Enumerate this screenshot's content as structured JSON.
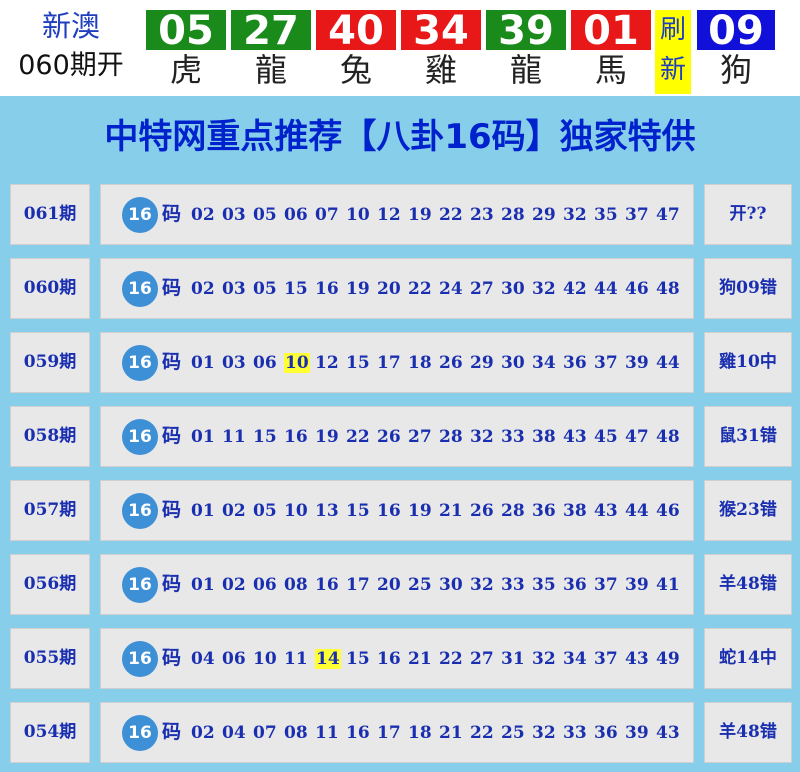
{
  "header": {
    "lottery_name": "新澳",
    "period_open": "060期开",
    "refresh_label": "刷新",
    "balls": [
      {
        "number": "05",
        "zodiac": "虎",
        "color": "#1a8a1a"
      },
      {
        "number": "27",
        "zodiac": "龍",
        "color": "#1a8a1a"
      },
      {
        "number": "40",
        "zodiac": "兔",
        "color": "#e81818"
      },
      {
        "number": "34",
        "zodiac": "雞",
        "color": "#e81818"
      },
      {
        "number": "39",
        "zodiac": "龍",
        "color": "#1a8a1a"
      },
      {
        "number": "01",
        "zodiac": "馬",
        "color": "#e81818"
      },
      {
        "number": "09",
        "zodiac": "狗",
        "color": "#1010d8"
      }
    ]
  },
  "banner": {
    "title": "中特网重点推荐【八卦16码】独家特供"
  },
  "badge_label": "16",
  "ma_label": "码",
  "rows": [
    {
      "period": "061期",
      "result": "开??",
      "highlight": "",
      "numbers": [
        "02",
        "03",
        "05",
        "06",
        "07",
        "10",
        "12",
        "19",
        "22",
        "23",
        "28",
        "29",
        "32",
        "35",
        "37",
        "47"
      ]
    },
    {
      "period": "060期",
      "result": "狗09错",
      "highlight": "",
      "numbers": [
        "02",
        "03",
        "05",
        "15",
        "16",
        "19",
        "20",
        "22",
        "24",
        "27",
        "30",
        "32",
        "42",
        "44",
        "46",
        "48"
      ]
    },
    {
      "period": "059期",
      "result": "雞10中",
      "highlight": "10",
      "numbers": [
        "01",
        "03",
        "06",
        "10",
        "12",
        "15",
        "17",
        "18",
        "26",
        "29",
        "30",
        "34",
        "36",
        "37",
        "39",
        "44"
      ]
    },
    {
      "period": "058期",
      "result": "鼠31错",
      "highlight": "",
      "numbers": [
        "01",
        "11",
        "15",
        "16",
        "19",
        "22",
        "26",
        "27",
        "28",
        "32",
        "33",
        "38",
        "43",
        "45",
        "47",
        "48"
      ]
    },
    {
      "period": "057期",
      "result": "猴23错",
      "highlight": "",
      "numbers": [
        "01",
        "02",
        "05",
        "10",
        "13",
        "15",
        "16",
        "19",
        "21",
        "26",
        "28",
        "36",
        "38",
        "43",
        "44",
        "46"
      ]
    },
    {
      "period": "056期",
      "result": "羊48错",
      "highlight": "",
      "numbers": [
        "01",
        "02",
        "06",
        "08",
        "16",
        "17",
        "20",
        "25",
        "30",
        "32",
        "33",
        "35",
        "36",
        "37",
        "39",
        "41"
      ]
    },
    {
      "period": "055期",
      "result": "蛇14中",
      "highlight": "14",
      "numbers": [
        "04",
        "06",
        "10",
        "11",
        "14",
        "15",
        "16",
        "21",
        "22",
        "27",
        "31",
        "32",
        "34",
        "37",
        "43",
        "49"
      ]
    },
    {
      "period": "054期",
      "result": "羊48错",
      "highlight": "",
      "numbers": [
        "02",
        "04",
        "07",
        "08",
        "11",
        "16",
        "17",
        "18",
        "21",
        "22",
        "25",
        "32",
        "33",
        "36",
        "39",
        "43"
      ]
    }
  ]
}
